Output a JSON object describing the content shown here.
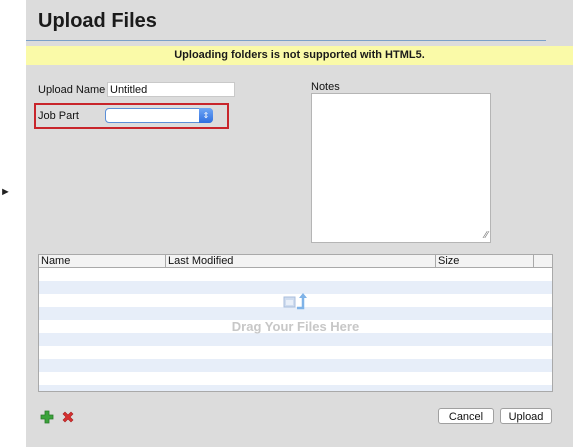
{
  "dialog": {
    "title": "Upload Files",
    "banner": "Uploading folders is not supported with HTML5."
  },
  "form": {
    "upload_name_label": "Upload Name",
    "upload_name_value": "Untitled",
    "job_part_label": "Job Part",
    "job_part_value": "",
    "notes_label": "Notes",
    "notes_value": ""
  },
  "table": {
    "columns": [
      "Name",
      "Last Modified",
      "Size",
      ""
    ],
    "drop_text": "Drag Your Files Here"
  },
  "footer": {
    "add_icon": "plus-icon",
    "remove_icon": "x-icon",
    "cancel_label": "Cancel",
    "upload_label": "Upload"
  },
  "colors": {
    "banner": "#fafaa8",
    "highlight": "#c8252b",
    "add": "#3aa33a",
    "remove": "#d63030"
  }
}
